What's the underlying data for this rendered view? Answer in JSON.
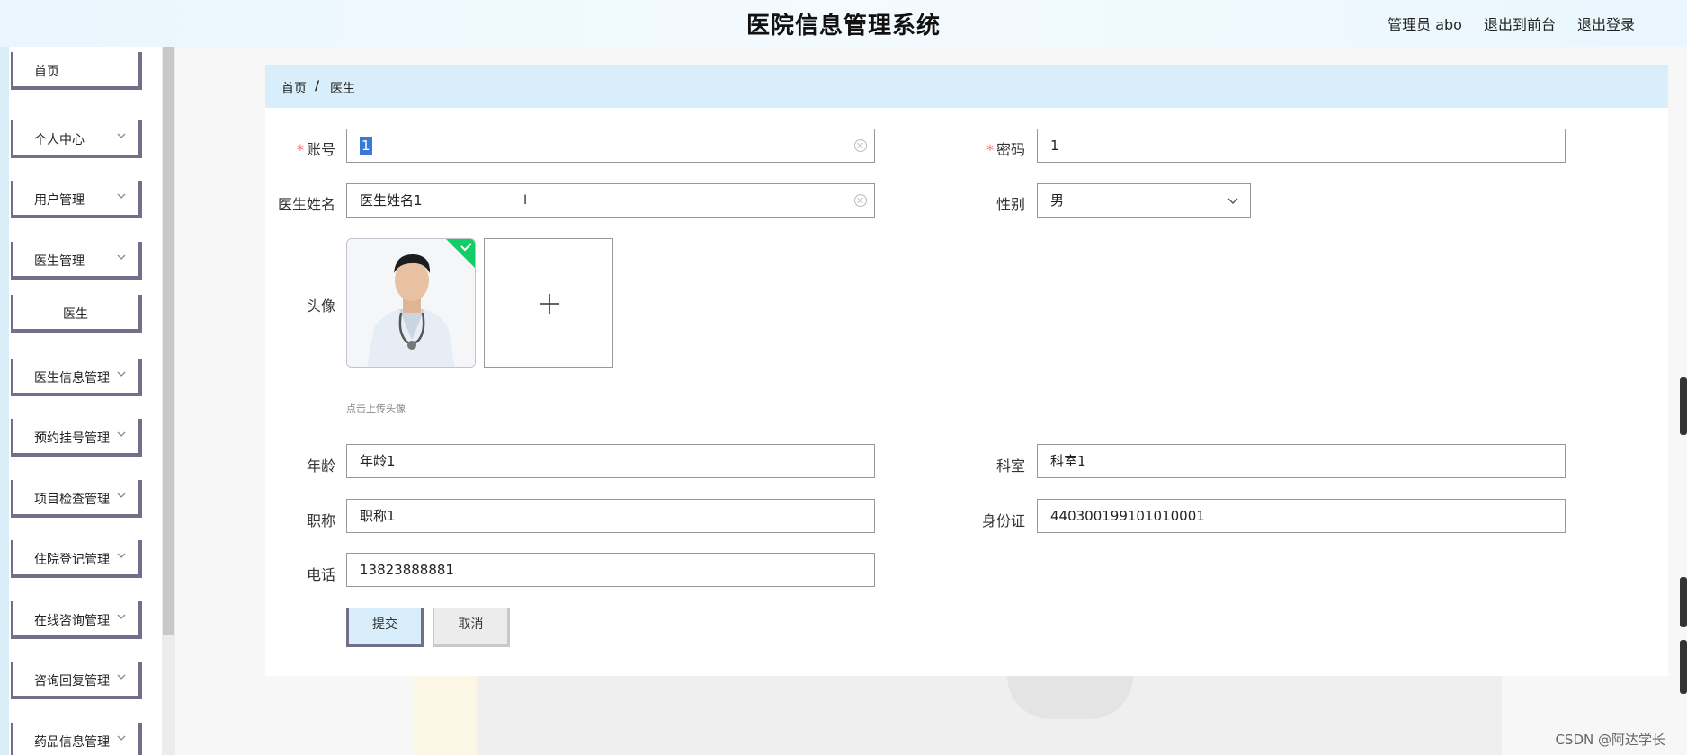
{
  "header": {
    "title": "医院信息管理系统",
    "user": "管理员 abo",
    "to_front": "退出到前台",
    "logout": "退出登录"
  },
  "sidebar": {
    "items": [
      {
        "label": "首页"
      },
      {
        "label": "个人中心"
      },
      {
        "label": "用户管理"
      },
      {
        "label": "医生管理"
      },
      {
        "label": "医生"
      },
      {
        "label": "医生信息管理"
      },
      {
        "label": "预约挂号管理"
      },
      {
        "label": "项目检查管理"
      },
      {
        "label": "住院登记管理"
      },
      {
        "label": "在线咨询管理"
      },
      {
        "label": "咨询回复管理"
      },
      {
        "label": "药品信息管理"
      }
    ]
  },
  "breadcrumb": {
    "home": "首页",
    "sep": "/",
    "current": "医生"
  },
  "form": {
    "account": {
      "label": "账号",
      "value": "1"
    },
    "password": {
      "label": "密码",
      "value": "1"
    },
    "doctor_name": {
      "label": "医生姓名",
      "value": "医生姓名1"
    },
    "gender": {
      "label": "性别",
      "value": "男"
    },
    "avatar": {
      "label": "头像",
      "hint": "点击上传头像"
    },
    "age": {
      "label": "年龄",
      "value": "年龄1"
    },
    "department": {
      "label": "科室",
      "value": "科室1"
    },
    "title": {
      "label": "职称",
      "value": "职称1"
    },
    "id_card": {
      "label": "身份证",
      "value": "440300199101010001"
    },
    "phone": {
      "label": "电话",
      "value": "13823888881"
    },
    "submit": "提交",
    "cancel": "取消"
  },
  "watermark": "CSDN @阿达学长",
  "colors": {
    "accent": "#d9eefb",
    "border": "#726f8b",
    "required": "#f56c6c",
    "success": "#13ce66"
  }
}
